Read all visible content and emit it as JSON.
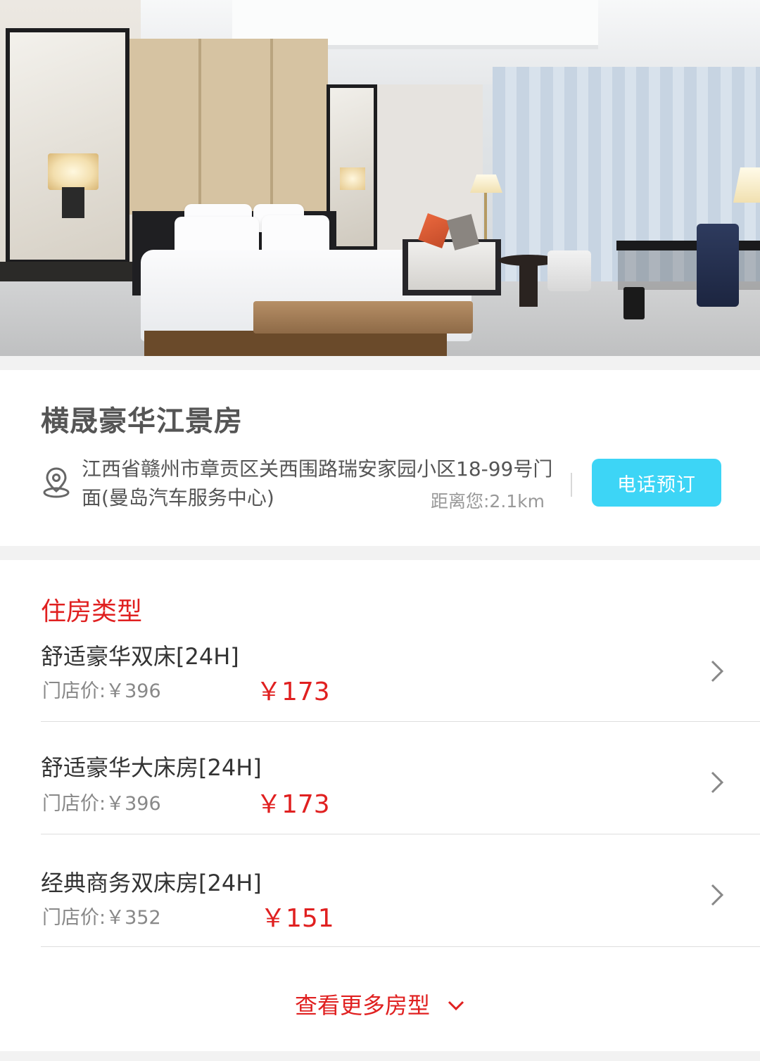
{
  "hotel": {
    "title": "横晟豪华江景房",
    "address": "江西省赣州市章贡区关西围路瑞安家园小区18-99号门面(曼岛汽车服务中心)",
    "distance": "距离您:2.1km",
    "call_button": "电话预订"
  },
  "rooms_section": {
    "title": "住房类型",
    "items": [
      {
        "name": "舒适豪华双床[24H]",
        "door_price": "门店价:￥396",
        "price": "￥173"
      },
      {
        "name": "舒适豪华大床房[24H]",
        "door_price": "门店价:￥396",
        "price": "￥173"
      },
      {
        "name": "经典商务双床房[24H]",
        "door_price": "门店价:￥352",
        "price": "￥151"
      }
    ],
    "more_label": "查看更多房型"
  },
  "icons": {
    "location": "location-pin-icon",
    "chevron_right": "chevron-right-icon",
    "chevron_down": "chevron-down-icon"
  },
  "colors": {
    "accent_red": "#e02020",
    "call_button_bg": "#3dd5f6",
    "page_bg": "#f2f2f2"
  }
}
